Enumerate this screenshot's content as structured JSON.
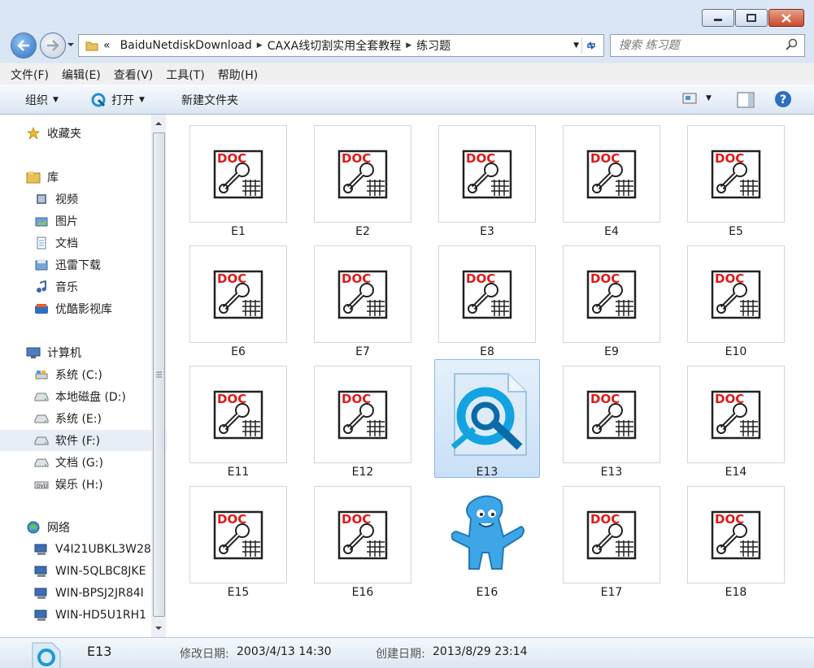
{
  "address": {
    "overflow": "«",
    "segments": [
      "BaiduNetdiskDownload",
      "CAXA线切割实用全套教程",
      "练习题"
    ]
  },
  "search": {
    "placeholder": "搜索 练习题"
  },
  "menu": [
    "文件(F)",
    "编辑(E)",
    "查看(V)",
    "工具(T)",
    "帮助(H)"
  ],
  "toolbar": {
    "organize": "组织",
    "open": "打开",
    "new_folder": "新建文件夹"
  },
  "sidebar": {
    "favorites": "收藏夹",
    "libraries": "库",
    "library_items": [
      "视频",
      "图片",
      "文档",
      "迅雷下载",
      "音乐",
      "优酷影视库"
    ],
    "computer": "计算机",
    "drives": [
      "系统 (C:)",
      "本地磁盘 (D:)",
      "系统 (E:)",
      "软件 (F:)",
      "文档 (G:)",
      "娱乐 (H:)"
    ],
    "selected_drive": "软件 (F:)",
    "network": "网络",
    "network_items": [
      "V4I21UBKL3W28",
      "WIN-5QLBC8JKE",
      "WIN-BPSJ2JR84I",
      "WIN-HD5U1RH1"
    ]
  },
  "files": [
    {
      "name": "E1",
      "icon": "doc-drawing-icon"
    },
    {
      "name": "E2",
      "icon": "doc-drawing-icon"
    },
    {
      "name": "E3",
      "icon": "doc-drawing-icon"
    },
    {
      "name": "E4",
      "icon": "doc-drawing-icon"
    },
    {
      "name": "E5",
      "icon": "doc-drawing-icon"
    },
    {
      "name": "E6",
      "icon": "doc-drawing-icon"
    },
    {
      "name": "E7",
      "icon": "doc-drawing-icon"
    },
    {
      "name": "E8",
      "icon": "doc-drawing-icon"
    },
    {
      "name": "E9",
      "icon": "doc-drawing-icon"
    },
    {
      "name": "E10",
      "icon": "doc-drawing-icon"
    },
    {
      "name": "E11",
      "icon": "doc-drawing-icon"
    },
    {
      "name": "E12",
      "icon": "doc-drawing-icon"
    },
    {
      "name": "E13",
      "icon": "caxa-file-icon",
      "selected": true
    },
    {
      "name": "E13",
      "icon": "doc-drawing-icon"
    },
    {
      "name": "E14",
      "icon": "doc-drawing-icon"
    },
    {
      "name": "E15",
      "icon": "doc-drawing-icon"
    },
    {
      "name": "E16",
      "icon": "doc-drawing-icon"
    },
    {
      "name": "E16",
      "icon": "mascot-image-icon"
    },
    {
      "name": "E17",
      "icon": "doc-drawing-icon"
    },
    {
      "name": "E18",
      "icon": "doc-drawing-icon"
    }
  ],
  "details": {
    "name": "E13",
    "modified_label": "修改日期:",
    "modified_value": "2003/4/13 14:30",
    "created_label": "创建日期:",
    "created_value": "2013/8/29 23:14"
  },
  "colors": {
    "selection": "#cce4f7",
    "accent": "#2f6fc0"
  }
}
